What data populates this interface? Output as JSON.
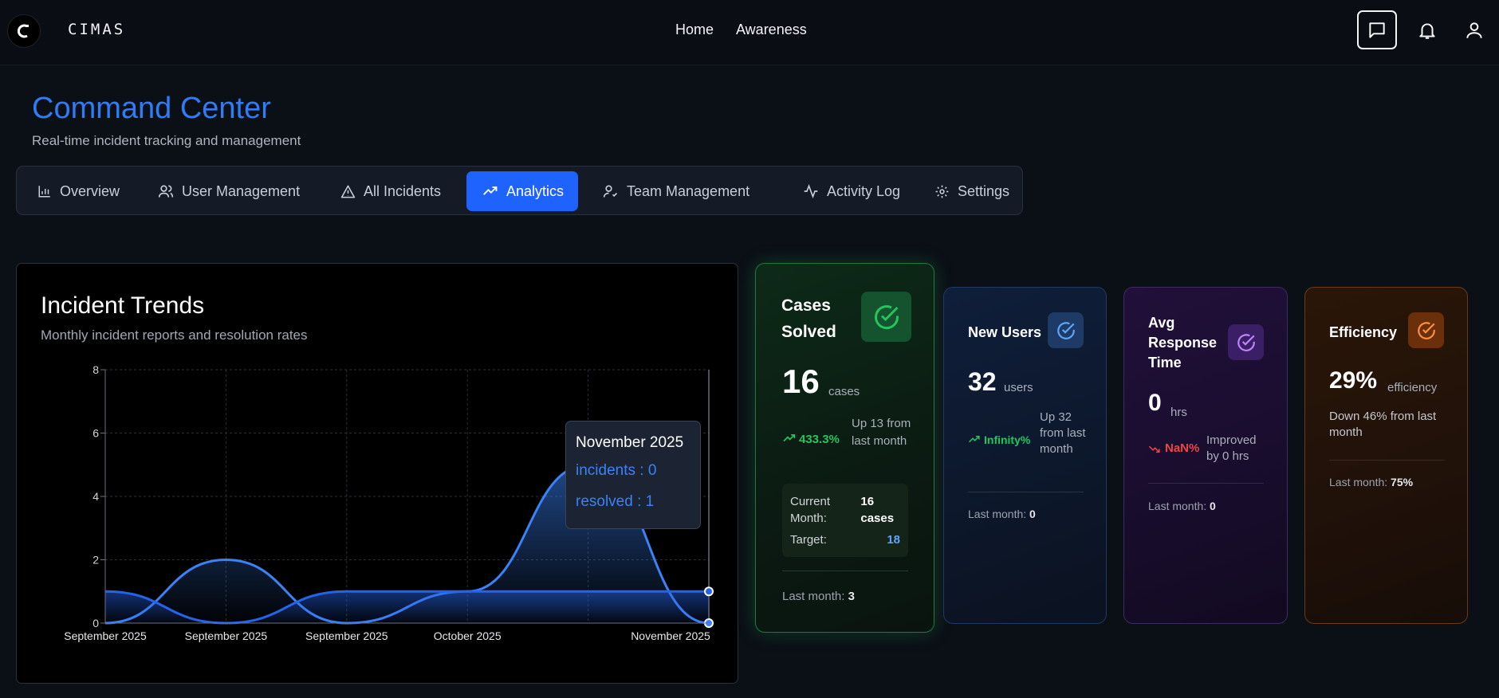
{
  "brand": {
    "name": "CIMAS"
  },
  "nav": {
    "links": [
      "Home",
      "Awareness"
    ]
  },
  "header": {
    "title": "Command Center",
    "subtitle": "Real-time incident tracking and management"
  },
  "tabs": [
    {
      "label": "Overview",
      "icon": "bar-chart-icon",
      "active": false
    },
    {
      "label": "User Management",
      "icon": "users-icon",
      "active": false
    },
    {
      "label": "All Incidents",
      "icon": "alert-triangle-icon",
      "active": false
    },
    {
      "label": "Analytics",
      "icon": "trending-up-icon",
      "active": true
    },
    {
      "label": "Team Management",
      "icon": "user-check-icon",
      "active": false
    },
    {
      "label": "Activity Log",
      "icon": "activity-icon",
      "active": false
    },
    {
      "label": "Settings",
      "icon": "gear-icon",
      "active": false
    }
  ],
  "chart": {
    "title": "Incident Trends",
    "subtitle": "Monthly incident reports and resolution rates",
    "tooltip": {
      "title": "November 2025",
      "incidents": "incidents : 0",
      "resolved": "resolved : 1"
    }
  },
  "chart_data": {
    "type": "area",
    "categories": [
      "September 2025",
      "September 2025",
      "September 2025",
      "October 2025",
      "November 2025",
      "November 2025"
    ],
    "series": [
      {
        "name": "incidents",
        "values": [
          0,
          2,
          0,
          1,
          5,
          0
        ],
        "color": "#3b82f6"
      },
      {
        "name": "resolved",
        "values": [
          1,
          0,
          1,
          1,
          1,
          1
        ],
        "color": "#2563eb"
      }
    ],
    "ylim": [
      0,
      8
    ],
    "yticks": [
      0,
      2,
      4,
      6,
      8
    ],
    "grid": true
  },
  "cards": {
    "cases": {
      "title": "Cases Solved",
      "value": "16",
      "unit": "cases",
      "change": "433.3%",
      "change_text": "Up 13 from last month",
      "current_month_label": "Current Month:",
      "current_month_value": "16 cases",
      "target_label": "Target:",
      "target_value": "18",
      "last_month_label": "Last month:",
      "last_month_value": "3",
      "accent": "#22c55e"
    },
    "users": {
      "title": "New Users",
      "value": "32",
      "unit": "users",
      "change": "Infinity%",
      "change_text": "Up 32 from last month",
      "last_month_label": "Last month:",
      "last_month_value": "0",
      "accent": "#60a5fa"
    },
    "response": {
      "title": "Avg Response Time",
      "value": "0",
      "unit": "hrs",
      "change": "NaN%",
      "change_text": "Improved by 0 hrs",
      "last_month_label": "Last month:",
      "last_month_value": "0",
      "accent": "#c084fc"
    },
    "efficiency": {
      "title": "Efficiency",
      "value": "29%",
      "unit": "efficiency",
      "change_text": "Down 46% from last month",
      "last_month_label": "Last month:",
      "last_month_value": "75%",
      "accent": "#fb923c"
    }
  }
}
